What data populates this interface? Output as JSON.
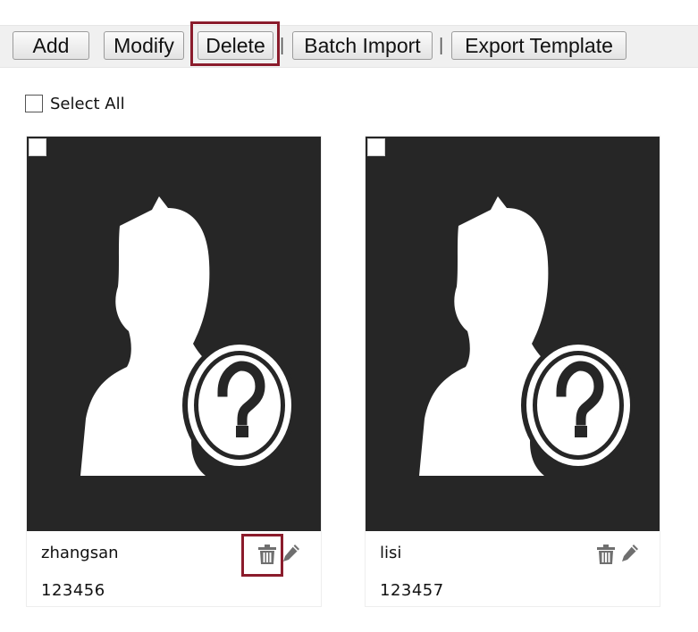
{
  "toolbar": {
    "add_label": "Add",
    "modify_label": "Modify",
    "delete_label": "Delete",
    "batch_import_label": "Batch Import",
    "export_template_label": "Export Template",
    "separator": "|"
  },
  "select_all": {
    "label": "Select All",
    "checked": false
  },
  "cards": [
    {
      "name": "zhangsan",
      "id": "123456",
      "photo_icon": "unknown-user-icon",
      "checked": false
    },
    {
      "name": "lisi",
      "id": "123457",
      "photo_icon": "unknown-user-icon",
      "checked": false
    }
  ],
  "icons": {
    "delete": "trash-icon",
    "edit": "pencil-icon"
  },
  "colors": {
    "highlight": "#8b1c2c",
    "photo_background": "#262626",
    "toolbar_background": "#f0f0f0",
    "icon_gray": "#6f6f6f"
  }
}
